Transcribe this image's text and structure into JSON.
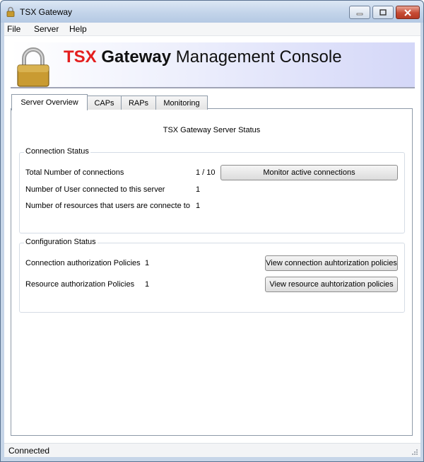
{
  "window": {
    "title": "TSX Gateway"
  },
  "menu": {
    "items": [
      "File",
      "Server",
      "Help"
    ]
  },
  "banner": {
    "title_part1": "TSX",
    "title_part2": "Gateway",
    "title_part3": "Management Console"
  },
  "tabs": [
    "Server Overview",
    "CAPs",
    "RAPs",
    "Monitoring"
  ],
  "overview": {
    "heading": "TSX Gateway Server Status",
    "connection_status": {
      "legend": "Connection Status",
      "rows": [
        {
          "label": "Total Number of connections",
          "value": "1 / 10"
        },
        {
          "label": "Number of User connected to this server",
          "value": "1"
        },
        {
          "label": "Number of resources that users are connecte to",
          "value": "1"
        }
      ],
      "button": "Monitor active connections"
    },
    "configuration_status": {
      "legend": "Configuration Status",
      "rows": [
        {
          "label": "Connection authorization Policies",
          "value": "1",
          "button": "View connection auhtorization policies"
        },
        {
          "label": "Resource authorization Policies",
          "value": "1",
          "button": "View resource auhtorization policies"
        }
      ]
    }
  },
  "status_bar": {
    "text": "Connected"
  },
  "colors": {
    "brand_red": "#e41e1e",
    "title_bar": "#c3d4ea",
    "close_button": "#c64a33"
  }
}
